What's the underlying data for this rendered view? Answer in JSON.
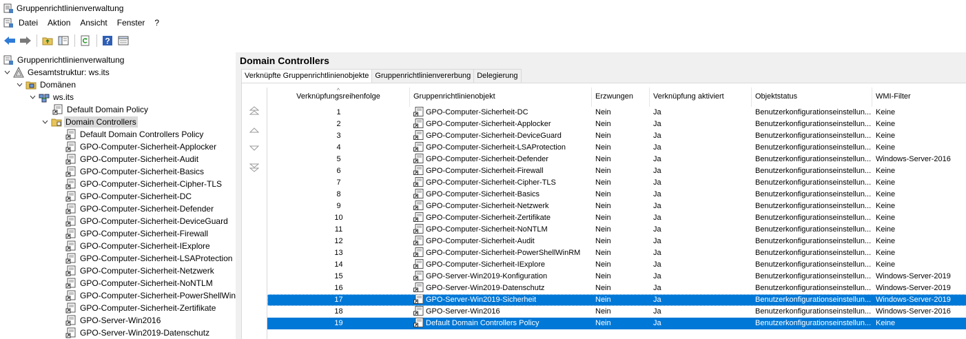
{
  "window": {
    "title": "Gruppenrichtlinienverwaltung"
  },
  "menu": [
    "Datei",
    "Aktion",
    "Ansicht",
    "Fenster",
    "?"
  ],
  "toolbar": {
    "buttons": [
      "back-icon",
      "forward-icon",
      "folder-up-icon",
      "show-hide-tree-icon",
      "refresh-icon",
      "help-icon",
      "properties-icon"
    ]
  },
  "tree": {
    "root": "Gruppenrichtlinienverwaltung",
    "forest": "Gesamtstruktur: ws.its",
    "domains": "Domänen",
    "domain": "ws.its",
    "default_domain_policy": "Default Domain Policy",
    "domain_controllers": "Domain Controllers",
    "children": [
      "Default Domain Controllers Policy",
      "GPO-Computer-Sicherheit-Applocker",
      "GPO-Computer-Sicherheit-Audit",
      "GPO-Computer-Sicherheit-Basics",
      "GPO-Computer-Sicherheit-Cipher-TLS",
      "GPO-Computer-Sicherheit-DC",
      "GPO-Computer-Sicherheit-Defender",
      "GPO-Computer-Sicherheit-DeviceGuard",
      "GPO-Computer-Sicherheit-Firewall",
      "GPO-Computer-Sicherheit-IExplore",
      "GPO-Computer-Sicherheit-LSAProtection",
      "GPO-Computer-Sicherheit-Netzwerk",
      "GPO-Computer-Sicherheit-NoNTLM",
      "GPO-Computer-Sicherheit-PowerShellWinRM",
      "GPO-Computer-Sicherheit-Zertifikate",
      "GPO-Server-Win2016",
      "GPO-Server-Win2019-Datenschutz"
    ]
  },
  "details": {
    "title": "Domain Controllers",
    "tabs": [
      "Verknüpfte Gruppenrichtlinienobjekte",
      "Gruppenrichtlinienvererbung",
      "Delegierung"
    ],
    "columns": [
      "Verknüpfungsreihenfolge",
      "Gruppenrichtlinienobjekt",
      "Erzwungen",
      "Verknüpfung aktiviert",
      "Objektstatus",
      "WMI-Filter"
    ],
    "rows": [
      {
        "order": "1",
        "gpo": "GPO-Computer-Sicherheit-DC",
        "enforced": "Nein",
        "enabled": "Ja",
        "status": "Benutzerkonfigurationseinstellun...",
        "wmi": "Keine"
      },
      {
        "order": "2",
        "gpo": "GPO-Computer-Sicherheit-Applocker",
        "enforced": "Nein",
        "enabled": "Ja",
        "status": "Benutzerkonfigurationseinstellun...",
        "wmi": "Keine"
      },
      {
        "order": "3",
        "gpo": "GPO-Computer-Sicherheit-DeviceGuard",
        "enforced": "Nein",
        "enabled": "Ja",
        "status": "Benutzerkonfigurationseinstellun...",
        "wmi": "Keine"
      },
      {
        "order": "4",
        "gpo": "GPO-Computer-Sicherheit-LSAProtection",
        "enforced": "Nein",
        "enabled": "Ja",
        "status": "Benutzerkonfigurationseinstellun...",
        "wmi": "Keine"
      },
      {
        "order": "5",
        "gpo": "GPO-Computer-Sicherheit-Defender",
        "enforced": "Nein",
        "enabled": "Ja",
        "status": "Benutzerkonfigurationseinstellun...",
        "wmi": "Windows-Server-2016"
      },
      {
        "order": "6",
        "gpo": "GPO-Computer-Sicherheit-Firewall",
        "enforced": "Nein",
        "enabled": "Ja",
        "status": "Benutzerkonfigurationseinstellun...",
        "wmi": "Keine"
      },
      {
        "order": "7",
        "gpo": "GPO-Computer-Sicherheit-Cipher-TLS",
        "enforced": "Nein",
        "enabled": "Ja",
        "status": "Benutzerkonfigurationseinstellun...",
        "wmi": "Keine"
      },
      {
        "order": "8",
        "gpo": "GPO-Computer-Sicherheit-Basics",
        "enforced": "Nein",
        "enabled": "Ja",
        "status": "Benutzerkonfigurationseinstellun...",
        "wmi": "Keine"
      },
      {
        "order": "9",
        "gpo": "GPO-Computer-Sicherheit-Netzwerk",
        "enforced": "Nein",
        "enabled": "Ja",
        "status": "Benutzerkonfigurationseinstellun...",
        "wmi": "Keine"
      },
      {
        "order": "10",
        "gpo": "GPO-Computer-Sicherheit-Zertifikate",
        "enforced": "Nein",
        "enabled": "Ja",
        "status": "Benutzerkonfigurationseinstellun...",
        "wmi": "Keine"
      },
      {
        "order": "11",
        "gpo": "GPO-Computer-Sicherheit-NoNTLM",
        "enforced": "Nein",
        "enabled": "Ja",
        "status": "Benutzerkonfigurationseinstellun...",
        "wmi": "Keine"
      },
      {
        "order": "12",
        "gpo": "GPO-Computer-Sicherheit-Audit",
        "enforced": "Nein",
        "enabled": "Ja",
        "status": "Benutzerkonfigurationseinstellun...",
        "wmi": "Keine"
      },
      {
        "order": "13",
        "gpo": "GPO-Computer-Sicherheit-PowerShellWinRM",
        "enforced": "Nein",
        "enabled": "Ja",
        "status": "Benutzerkonfigurationseinstellun...",
        "wmi": "Keine"
      },
      {
        "order": "14",
        "gpo": "GPO-Computer-Sicherheit-IExplore",
        "enforced": "Nein",
        "enabled": "Ja",
        "status": "Benutzerkonfigurationseinstellun...",
        "wmi": "Keine"
      },
      {
        "order": "15",
        "gpo": "GPO-Server-Win2019-Konfiguration",
        "enforced": "Nein",
        "enabled": "Ja",
        "status": "Benutzerkonfigurationseinstellun...",
        "wmi": "Windows-Server-2019"
      },
      {
        "order": "16",
        "gpo": "GPO-Server-Win2019-Datenschutz",
        "enforced": "Nein",
        "enabled": "Ja",
        "status": "Benutzerkonfigurationseinstellun...",
        "wmi": "Windows-Server-2019"
      },
      {
        "order": "17",
        "gpo": "GPO-Server-Win2019-Sicherheit",
        "enforced": "Nein",
        "enabled": "Ja",
        "status": "Benutzerkonfigurationseinstellun...",
        "wmi": "Windows-Server-2019",
        "selected": true
      },
      {
        "order": "18",
        "gpo": "GPO-Server-Win2016",
        "enforced": "Nein",
        "enabled": "Ja",
        "status": "Benutzerkonfigurationseinstellun...",
        "wmi": "Windows-Server-2016"
      },
      {
        "order": "19",
        "gpo": "Default Domain Controllers Policy",
        "enforced": "Nein",
        "enabled": "Ja",
        "status": "Benutzerkonfigurationseinstellun...",
        "wmi": "Keine",
        "selected": true
      }
    ]
  },
  "colors": {
    "selection": "#0078d7",
    "tree_selection": "#d9d9d9"
  }
}
